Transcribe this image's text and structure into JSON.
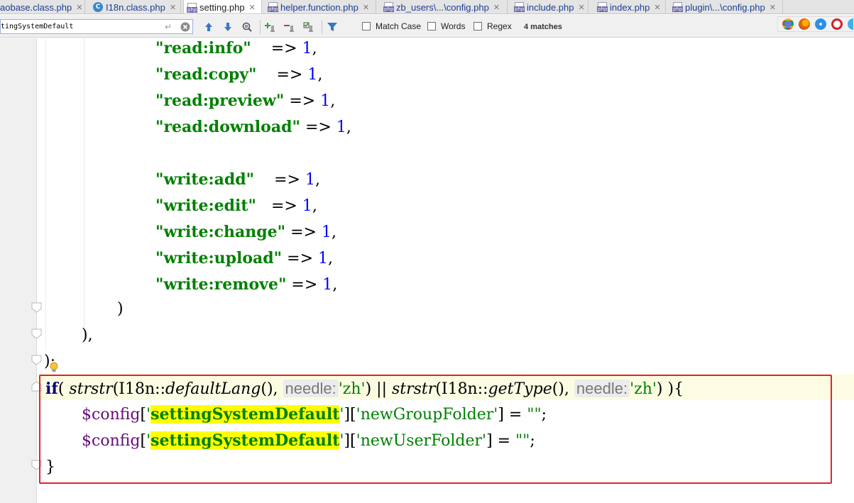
{
  "tabs": [
    {
      "label": "aobase.class.php",
      "icon": "php-file-icon"
    },
    {
      "label": "I18n.class.php",
      "icon": "class-file-icon"
    },
    {
      "label": "setting.php",
      "icon": "php-file-icon",
      "active": true
    },
    {
      "label": "helper.function.php",
      "icon": "php-file-icon"
    },
    {
      "label": "zb_users\\...\\config.php",
      "icon": "php-file-icon"
    },
    {
      "label": "include.php",
      "icon": "php-file-icon"
    },
    {
      "label": "index.php",
      "icon": "php-file-icon"
    },
    {
      "label": "plugin\\...\\config.php",
      "icon": "php-file-icon"
    }
  ],
  "search": {
    "query": "tingSystemDefault",
    "match_case_label": "Match Case",
    "words_label": "Words",
    "regex_label": "Regex",
    "matches": "4 matches"
  },
  "code": {
    "perm_lines": [
      {
        "key": "\"read:info\"",
        "pad": "    ",
        "value": "1"
      },
      {
        "key": "\"read:copy\"",
        "pad": "    ",
        "value": "1"
      },
      {
        "key": "\"read:preview\"",
        "pad": " ",
        "value": "1"
      },
      {
        "key": "\"read:download\"",
        "pad": " ",
        "value": "1"
      },
      {
        "key": "\"write:add\"",
        "pad": "    ",
        "value": "1"
      },
      {
        "key": "\"write:edit\"",
        "pad": "   ",
        "value": "1"
      },
      {
        "key": "\"write:change\"",
        "pad": " ",
        "value": "1"
      },
      {
        "key": "\"write:upload\"",
        "pad": " ",
        "value": "1"
      },
      {
        "key": "\"write:remove\"",
        "pad": " ",
        "value": "1"
      }
    ],
    "arrow": "=>",
    "close_paren": ")",
    "close_paren_comma": "),",
    "close_stmt": ");",
    "if_keyword": "if",
    "fn_strstr": "strstr",
    "class_name": "I18n",
    "method_default_lang": "defaultLang",
    "method_get_type": "getType",
    "hint_needle": "needle:",
    "str_zh": "'zh'",
    "or_op": "||",
    "var_config": "$config",
    "key_setting": "settingSystemDefault",
    "key_group": "'newGroupFolder'",
    "key_user": "'newUserFolder'",
    "empty_string": "\"\"",
    "close_brace": "}"
  },
  "colors": {
    "string": "#008000",
    "number": "#0000ff",
    "keyword": "#000080",
    "variable": "#660e7a",
    "search_highlight": "#ffff00",
    "annotation_box": "#e2232a"
  },
  "browser_icons": [
    "chrome-icon",
    "firefox-icon",
    "safari-icon",
    "opera-icon",
    "ie-icon"
  ]
}
